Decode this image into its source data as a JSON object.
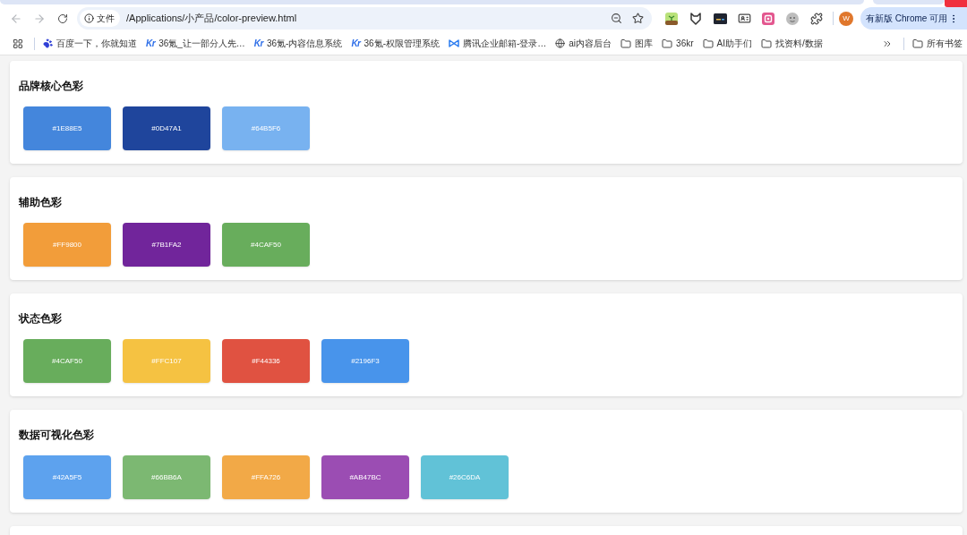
{
  "browser": {
    "scheme_label": "文件",
    "url": "/Applications/小产品/color-preview.html",
    "avatar_letter": "W",
    "update_button": "有新版 Chrome 可用"
  },
  "bookmarks": [
    {
      "kind": "baidu",
      "label": "百度一下，你就知道"
    },
    {
      "kind": "kr",
      "logo": "Kr",
      "label": "36氪_让一部分人先…"
    },
    {
      "kind": "kr",
      "logo": "Kr",
      "label": "36氪-内容信息系统"
    },
    {
      "kind": "kr",
      "logo": "Kr",
      "label": "36氪-权限管理系统"
    },
    {
      "kind": "mail",
      "label": "腾讯企业邮箱-登录…"
    },
    {
      "kind": "globe",
      "label": "ai内容后台"
    },
    {
      "kind": "folder",
      "label": "图库"
    },
    {
      "kind": "folder",
      "label": "36kr"
    },
    {
      "kind": "folder",
      "label": "AI助手们"
    },
    {
      "kind": "folder",
      "label": "找资料/数据"
    }
  ],
  "all_bookmarks": "所有书签",
  "sections": [
    {
      "title": "品牌核心色彩",
      "swatches": [
        {
          "label": "#1E88E5",
          "color": "#4486dc"
        },
        {
          "label": "#0D47A1",
          "color": "#1f459c"
        },
        {
          "label": "#64B5F6",
          "color": "#78b2f0"
        }
      ]
    },
    {
      "title": "辅助色彩",
      "swatches": [
        {
          "label": "#FF9800",
          "color": "#f29d3a"
        },
        {
          "label": "#7B1FA2",
          "color": "#71259b"
        },
        {
          "label": "#4CAF50",
          "color": "#68ad5c"
        }
      ]
    },
    {
      "title": "状态色彩",
      "swatches": [
        {
          "label": "#4CAF50",
          "color": "#68ad5c"
        },
        {
          "label": "#FFC107",
          "color": "#f5c242"
        },
        {
          "label": "#F44336",
          "color": "#e05241"
        },
        {
          "label": "#2196F3",
          "color": "#4894eb"
        }
      ]
    },
    {
      "title": "数据可视化色彩",
      "swatches": [
        {
          "label": "#42A5F5",
          "color": "#5da2ee"
        },
        {
          "label": "#66BB6A",
          "color": "#7cb872"
        },
        {
          "label": "#FFA726",
          "color": "#f2a947"
        },
        {
          "label": "#AB47BC",
          "color": "#9b4db3"
        },
        {
          "label": "#26C6DA",
          "color": "#61c2d7"
        }
      ]
    }
  ]
}
